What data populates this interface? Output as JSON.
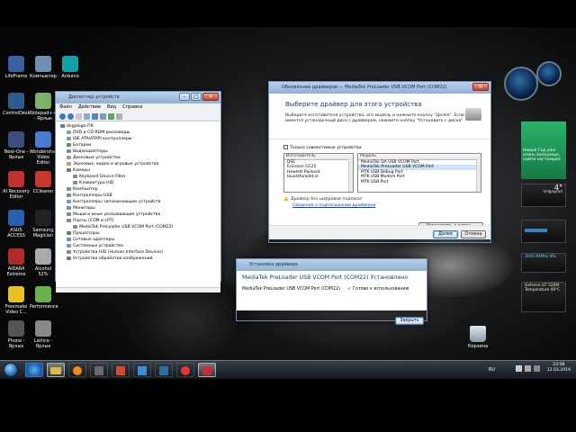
{
  "desktop_icons": [
    {
      "label": "LifeFrame",
      "color": "#3a5fa0"
    },
    {
      "label": "Компьютер",
      "color": "#6f8fb5"
    },
    {
      "label": "Arduino",
      "color": "#11a0a8"
    },
    {
      "label": "ControlDesk",
      "color": "#2d5d8c"
    },
    {
      "label": "Notepad++ - Ярлык",
      "color": "#7bb36a"
    },
    {
      "label": "Nest-One - Ярлык",
      "color": "#3c4e80"
    },
    {
      "label": "Wondershare Video Editor",
      "color": "#4a7bd0"
    },
    {
      "label": "AI Recovery Editor",
      "color": "#c03030"
    },
    {
      "label": "CCleaner",
      "color": "#c9382d"
    },
    {
      "label": "ASUS ACCESS",
      "color": "#2860b0"
    },
    {
      "label": "Samsung Magician",
      "color": "#222"
    },
    {
      "label": "AIDA64 Extreme",
      "color": "#b02a2a"
    },
    {
      "label": "Alcohol 52%",
      "color": "#aaa"
    },
    {
      "label": "Freemake Video C...",
      "color": "#e8c020"
    },
    {
      "label": "Performance",
      "color": "#6ab04c"
    },
    {
      "label": "Phone - Ярлык",
      "color": "#555"
    },
    {
      "label": "Lattice - Ярлык",
      "color": "#888"
    }
  ],
  "device_manager": {
    "title": "Диспетчер устройств",
    "menu": [
      "Файл",
      "Действие",
      "Вид",
      "Справка"
    ],
    "tree": [
      {
        "label": "dogjdogo-ПК",
        "level": 0,
        "color": "#5a7fae"
      },
      {
        "label": "DVD и CD-ROM дисководы",
        "level": 1,
        "color": "#999"
      },
      {
        "label": "IDE ATA/ATAPI контроллеры",
        "level": 1,
        "color": "#7a9ac5"
      },
      {
        "label": "Батареи",
        "level": 1,
        "color": "#4c9f4c"
      },
      {
        "label": "Видеоадаптеры",
        "level": 1,
        "color": "#6b8ec2"
      },
      {
        "label": "Дисковые устройства",
        "level": 1,
        "color": "#999"
      },
      {
        "label": "Звуковые, видео и игровые устройства",
        "level": 1,
        "color": "#c0a060"
      },
      {
        "label": "Камеры",
        "level": 1,
        "color": "#777"
      },
      {
        "label": "Keyboard Device Filter",
        "level": 2,
        "color": "#888"
      },
      {
        "label": "Клавиатура HID",
        "level": 2,
        "color": "#888"
      },
      {
        "label": "Компьютер",
        "level": 1,
        "color": "#6f8fb5"
      },
      {
        "label": "Контроллеры USB",
        "level": 1,
        "color": "#888"
      },
      {
        "label": "Контроллеры запоминающих устройств",
        "level": 1,
        "color": "#7a9ac5"
      },
      {
        "label": "Мониторы",
        "level": 1,
        "color": "#6b8ec2"
      },
      {
        "label": "Мыши и иные указывающие устройства",
        "level": 1,
        "color": "#888"
      },
      {
        "label": "Порты (COM и LPT)",
        "level": 1,
        "color": "#888"
      },
      {
        "label": "MediaTek PreLoader USB VCOM Port (COM22)",
        "level": 2,
        "color": "#888"
      },
      {
        "label": "Процессоры",
        "level": 1,
        "color": "#5a8a5a"
      },
      {
        "label": "Сетевые адаптеры",
        "level": 1,
        "color": "#6b8ec2"
      },
      {
        "label": "Системные устройства",
        "level": 1,
        "color": "#7a9ac5"
      },
      {
        "label": "Устройства HID (Human Interface Devices)",
        "level": 1,
        "color": "#888"
      },
      {
        "label": "Устройства обработки изображений",
        "level": 1,
        "color": "#777"
      }
    ]
  },
  "driver_dialog": {
    "title": "Обновление драйверов — MediaTek PreLoader USB VCOM Port (COM22)",
    "heading": "Выберите драйвер для этого устройства",
    "description": "Выберите изготовителя устройства, его модель и нажмите кнопку \"Далее\". Если имеется установочный диск с драйвером, нажмите кнопку \"Установить с диска\".",
    "checkbox_label": "Только совместимые устройства",
    "manufacturer_header": "Изготовитель",
    "manufacturers": [
      "DSC",
      "Ericsson GC25",
      "Hewlett Packard",
      "lausetfunklet.io"
    ],
    "model_header": "Модель",
    "models": [
      "MediaTek DA USB VCOM Port",
      "MediaTek PreLoader USB VCOM Port",
      "MTK USB Debug Port",
      "MTK USB Modem Port",
      "MTK USB Port"
    ],
    "selected_model_index": 1,
    "warning": "Драйвер без цифровой подписи!",
    "link": "Сведения о подписывании драйверов",
    "install_disk_button": "Установить с диска...",
    "next_button": "Далее",
    "cancel_button": "Отмена"
  },
  "install_popup": {
    "title": "Установка драйвера",
    "heading": "MediaTek PreLoader USB VCOM Port (COM22) Установлено",
    "device": "MediaTek PreLoader USB VCOM Port (COM22)",
    "status": "Готово к использованию",
    "close_button": "Закрыть"
  },
  "gadgets": {
    "news_tile": "Новый Год уже очень волнующе, найти настоящее",
    "weather_city": "Volgograd",
    "weather_temp": "4°",
    "net_widget": "3045.94Mhz 8%",
    "gpu_widget": "GeForce GT 520M Temperature 49°C",
    "recycle_bin": "Корзина"
  },
  "taskbar": {
    "lang": "RU",
    "time": "23:08",
    "date": "12.03.2019"
  },
  "colors": {
    "accent": "#2a6fb5",
    "titlebar": "#8fb0d6",
    "selection": "#cfe3f7",
    "tile_green": "#157a43"
  }
}
